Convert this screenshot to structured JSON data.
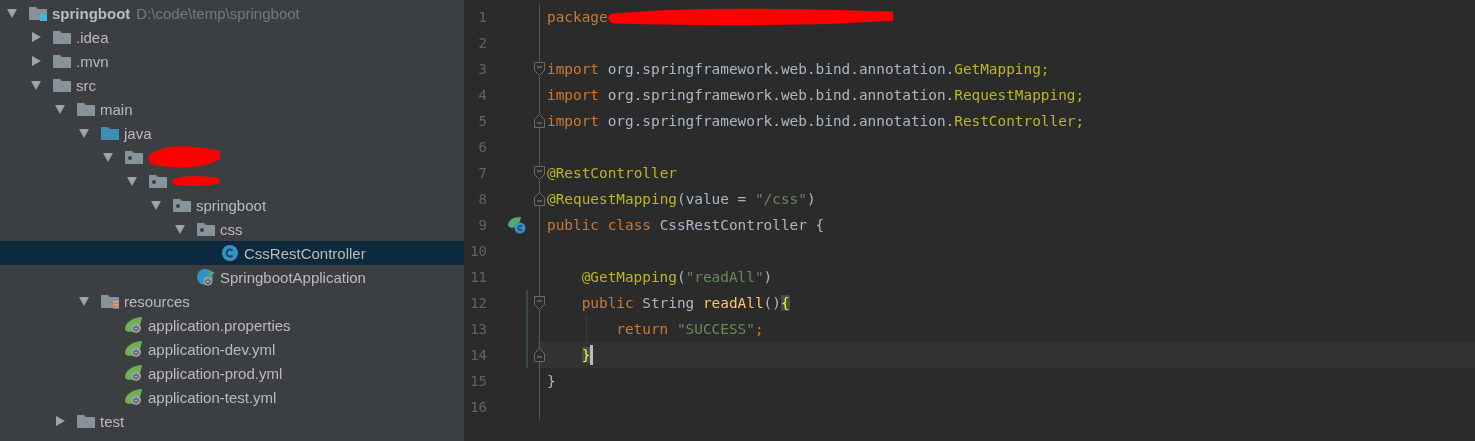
{
  "project_tree": {
    "root": {
      "name": "springboot",
      "path": "D:\\code\\temp\\springboot",
      "expanded": true
    },
    "items": [
      {
        "label": ".idea",
        "kind": "folder",
        "expanded": false,
        "selected": false
      },
      {
        "label": ".mvn",
        "kind": "folder",
        "expanded": false,
        "selected": false
      },
      {
        "label": "src",
        "kind": "folder",
        "expanded": true,
        "selected": false,
        "children": [
          {
            "label": "main",
            "kind": "folder",
            "expanded": true,
            "selected": false,
            "children": [
              {
                "label": "java",
                "kind": "source",
                "expanded": true,
                "selected": false,
                "children": [
                  {
                    "redacted": true,
                    "kind": "package",
                    "expanded": true,
                    "selected": false,
                    "children": [
                      {
                        "redacted": true,
                        "kind": "package",
                        "expanded": true,
                        "selected": false,
                        "children": [
                          {
                            "label": "springboot",
                            "kind": "package",
                            "expanded": true,
                            "selected": false,
                            "children": [
                              {
                                "label": "css",
                                "kind": "package",
                                "expanded": true,
                                "selected": false,
                                "children": [
                                  {
                                    "label": "CssRestController",
                                    "kind": "class",
                                    "selected": true
                                  }
                                ]
                              },
                              {
                                "label": "SpringbootApplication",
                                "kind": "application",
                                "selected": false
                              }
                            ]
                          }
                        ]
                      }
                    ]
                  }
                ]
              },
              {
                "label": "resources",
                "kind": "resources",
                "expanded": true,
                "selected": false,
                "children": [
                  {
                    "label": "application.properties",
                    "kind": "config",
                    "selected": false
                  },
                  {
                    "label": "application-dev.yml",
                    "kind": "config",
                    "selected": false
                  },
                  {
                    "label": "application-prod.yml",
                    "kind": "config",
                    "selected": false
                  },
                  {
                    "label": "application-test.yml",
                    "kind": "config",
                    "selected": false
                  }
                ]
              }
            ]
          },
          {
            "label": "test",
            "kind": "folder",
            "expanded": false,
            "selected": false
          }
        ]
      }
    ]
  },
  "editor": {
    "lines": [
      {
        "number": "1",
        "kind": "top",
        "tokens": [
          {
            "kind": "keyword",
            "text": "package"
          },
          {
            "kind": "redacted"
          }
        ]
      },
      {
        "number": "2",
        "kind": "top"
      },
      {
        "number": "3",
        "kind": "top",
        "fold_start": true,
        "tokens": [
          {
            "kind": "keyword",
            "text": "import"
          },
          {
            "kind": "plain",
            "text": " org.springframework.web.bind.annotation."
          },
          {
            "kind": "imported",
            "text": "GetMapping;"
          }
        ]
      },
      {
        "number": "4",
        "kind": "top",
        "tokens": [
          {
            "kind": "keyword",
            "text": "import"
          },
          {
            "kind": "plain",
            "text": " org.springframework.web.bind.annotation."
          },
          {
            "kind": "imported",
            "text": "RequestMapping;"
          }
        ]
      },
      {
        "number": "5",
        "kind": "top",
        "fold_end": true,
        "tokens": [
          {
            "kind": "keyword",
            "text": "import"
          },
          {
            "kind": "plain",
            "text": " org.springframework.web.bind.annotation."
          },
          {
            "kind": "imported",
            "text": "RestController;"
          }
        ]
      },
      {
        "number": "6",
        "kind": "top"
      },
      {
        "number": "7",
        "kind": "top",
        "fold_start": true,
        "tokens": [
          {
            "kind": "annotation",
            "text": "@RestController"
          }
        ]
      },
      {
        "number": "8",
        "kind": "top",
        "fold_end": true,
        "tokens": [
          {
            "kind": "annotation",
            "text": "@RequestMapping"
          },
          {
            "kind": "plain",
            "text": "(value = "
          },
          {
            "kind": "string",
            "text": "\"/css\""
          },
          {
            "kind": "plain",
            "text": ")"
          }
        ]
      },
      {
        "number": "9",
        "kind": "top",
        "bean_icon": true,
        "tokens": [
          {
            "kind": "keyword",
            "text": "public class "
          },
          {
            "kind": "plain",
            "text": "CssRestController {"
          }
        ]
      },
      {
        "number": "10",
        "kind": "top"
      },
      {
        "number": "11",
        "kind": "member",
        "tokens": [
          {
            "kind": "annotation",
            "text": "@GetMapping"
          },
          {
            "kind": "plain",
            "text": "("
          },
          {
            "kind": "string",
            "text": "\"readAll\""
          },
          {
            "kind": "plain",
            "text": ")"
          }
        ]
      },
      {
        "number": "12",
        "kind": "member",
        "fold_start": true,
        "changed": true,
        "tokens": [
          {
            "kind": "keyword",
            "text": "public "
          },
          {
            "kind": "plain",
            "text": "String "
          },
          {
            "kind": "method",
            "text": "readAll"
          },
          {
            "kind": "plain",
            "text": "()"
          },
          {
            "kind": "brace-match",
            "text": "{"
          }
        ]
      },
      {
        "number": "13",
        "kind": "body",
        "changed": true,
        "indent_guide": true,
        "tokens": [
          {
            "kind": "keyword",
            "text": "return "
          },
          {
            "kind": "string",
            "text": "\"SUCCESS\""
          },
          {
            "kind": "keyword",
            "text": ";"
          }
        ]
      },
      {
        "number": "14",
        "kind": "member",
        "fold_end": true,
        "changed": true,
        "current": true,
        "caret": true,
        "tokens": [
          {
            "kind": "brace-match",
            "text": "}"
          }
        ]
      },
      {
        "number": "15",
        "kind": "top",
        "tokens": [
          {
            "kind": "plain",
            "text": "}"
          }
        ]
      },
      {
        "number": "16",
        "kind": "top"
      }
    ]
  }
}
